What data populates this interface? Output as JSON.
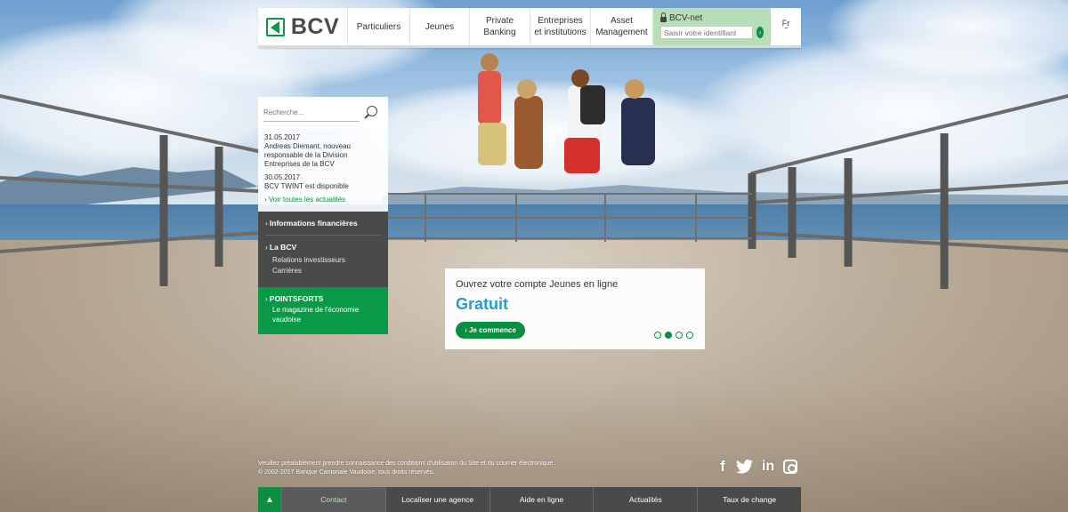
{
  "header": {
    "logo_text": "BCV",
    "nav": [
      "Particuliers",
      "Jeunes",
      "Private Banking",
      "Entreprises et institutions",
      "Asset Management"
    ],
    "bcvnet_title": "BCV-net",
    "bcvnet_placeholder": "Saisir votre identifiant",
    "language": "Fr"
  },
  "sidebar": {
    "search_placeholder": "Recherche...",
    "news": [
      {
        "date": "31.05.2017",
        "text": "Andreas Diemant, nouveau responsable de la Division Entreprises de la BCV"
      },
      {
        "date": "30.05.2017",
        "text": "BCV TWINT est disponible"
      }
    ],
    "news_link": "Voir toutes les actualités",
    "financial_info": "Informations financières",
    "bcv_heading": "La BCV",
    "bcv_links": [
      "Relations investisseurs",
      "Carrières"
    ],
    "pointsforts_heading": "POINTSFORTS",
    "pointsforts_text": "Le magazine de l'économie vaudoise"
  },
  "promo": {
    "title": "Ouvrez votre compte Jeunes en ligne",
    "highlight": "Gratuit",
    "button": "Je commence",
    "slides_total": 4,
    "slide_active": 2
  },
  "footer": {
    "legal_line1": "Veuillez préalablement prendre connaissance des conditions d'utilisation du Site et du courrier électronique.",
    "legal_line2": "© 2002-2017 Banque Cantonale Vaudoise, tous droits réservés.",
    "socials": [
      "facebook-icon",
      "twitter-icon",
      "linkedin-icon",
      "instagram-icon"
    ],
    "links": [
      "Contact",
      "Localiser une agence",
      "Aide en ligne",
      "Actualités",
      "Taux de change"
    ]
  },
  "colors": {
    "brand_green": "#0a9a47",
    "dark": "#4a4a4a",
    "accent_blue": "#2a9bd1"
  }
}
